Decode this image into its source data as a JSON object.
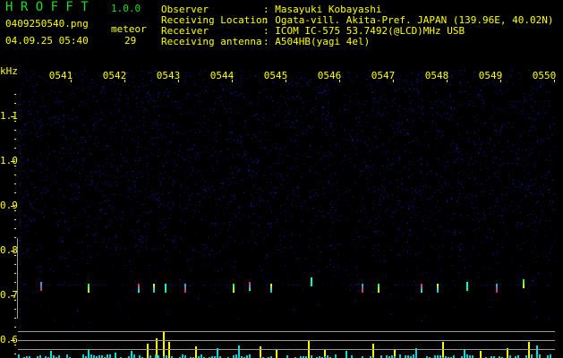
{
  "app": {
    "title": "H R O F F T",
    "version": "1.0.0"
  },
  "file": {
    "name": "0409250540.png",
    "datetime": "04.09.25 05:40"
  },
  "meteor": {
    "label": "meteor",
    "count": "29"
  },
  "info": [
    {
      "label": "Observer",
      "value": ": Masayuki Kobayashi"
    },
    {
      "label": "Receiving Location",
      "value": ": Ogata-vill. Akita-Pref. JAPAN (139.96E, 40.02N)"
    },
    {
      "label": "Receiver",
      "value": ": ICOM IC-575 53.7492(@LCD)MHz USB"
    },
    {
      "label": "Receiving antenna",
      "value": ": A504HB(yagi 4el)"
    }
  ],
  "axis": {
    "unit": "kHz",
    "freq_labels": [
      "1.1",
      "1.0",
      "0.9",
      "0.8",
      "0.7",
      "0.6"
    ],
    "freq_values": [
      1.1,
      1.0,
      0.9,
      0.8,
      0.7,
      0.6
    ],
    "time_labels": [
      "0541",
      "0542",
      "0543",
      "0544",
      "0545",
      "0546",
      "0547",
      "0548",
      "0549",
      "0550"
    ]
  },
  "colors": {
    "text": "#ffff00",
    "title": "#22dd22",
    "noise": "#2020c0",
    "count_bar": "#00e0e0",
    "meteor_bar": "#ffff00",
    "grid": "#9a9a9a"
  },
  "events": [
    {
      "t": 0.62,
      "f": 0.725
    },
    {
      "t": 1.5,
      "f": 0.72
    },
    {
      "t": 2.44,
      "f": 0.72
    },
    {
      "t": 2.72,
      "f": 0.72
    },
    {
      "t": 2.93,
      "f": 0.72
    },
    {
      "t": 3.3,
      "f": 0.72
    },
    {
      "t": 4.2,
      "f": 0.72
    },
    {
      "t": 4.5,
      "f": 0.725
    },
    {
      "t": 4.9,
      "f": 0.72
    },
    {
      "t": 5.65,
      "f": 0.735
    },
    {
      "t": 6.6,
      "f": 0.72
    },
    {
      "t": 6.9,
      "f": 0.72
    },
    {
      "t": 7.7,
      "f": 0.72
    },
    {
      "t": 8.0,
      "f": 0.72
    },
    {
      "t": 8.55,
      "f": 0.725
    },
    {
      "t": 9.1,
      "f": 0.72
    },
    {
      "t": 9.6,
      "f": 0.73
    }
  ],
  "bars": [
    {
      "t": 0.8,
      "v": 0.25,
      "m": false
    },
    {
      "t": 1.5,
      "v": 0.3,
      "m": false
    },
    {
      "t": 2.0,
      "v": 0.2,
      "m": false
    },
    {
      "t": 2.3,
      "v": 0.25,
      "m": false
    },
    {
      "t": 2.6,
      "v": 0.5,
      "m": true
    },
    {
      "t": 2.76,
      "v": 0.7,
      "m": true
    },
    {
      "t": 2.9,
      "v": 0.95,
      "m": true
    },
    {
      "t": 3.0,
      "v": 0.55,
      "m": true
    },
    {
      "t": 3.5,
      "v": 0.4,
      "m": true
    },
    {
      "t": 3.9,
      "v": 0.35,
      "m": false
    },
    {
      "t": 4.3,
      "v": 0.45,
      "m": false
    },
    {
      "t": 4.7,
      "v": 0.4,
      "m": true
    },
    {
      "t": 5.0,
      "v": 0.3,
      "m": true
    },
    {
      "t": 5.6,
      "v": 0.6,
      "m": true
    },
    {
      "t": 5.9,
      "v": 0.3,
      "m": true
    },
    {
      "t": 6.3,
      "v": 0.25,
      "m": false
    },
    {
      "t": 6.8,
      "v": 0.5,
      "m": true
    },
    {
      "t": 7.2,
      "v": 0.3,
      "m": true
    },
    {
      "t": 7.6,
      "v": 0.35,
      "m": false
    },
    {
      "t": 8.1,
      "v": 0.55,
      "m": true
    },
    {
      "t": 8.5,
      "v": 0.3,
      "m": false
    },
    {
      "t": 8.8,
      "v": 0.25,
      "m": true
    },
    {
      "t": 9.3,
      "v": 0.35,
      "m": true
    },
    {
      "t": 9.7,
      "v": 0.55,
      "m": true
    },
    {
      "t": 9.85,
      "v": 0.45,
      "m": false
    }
  ]
}
